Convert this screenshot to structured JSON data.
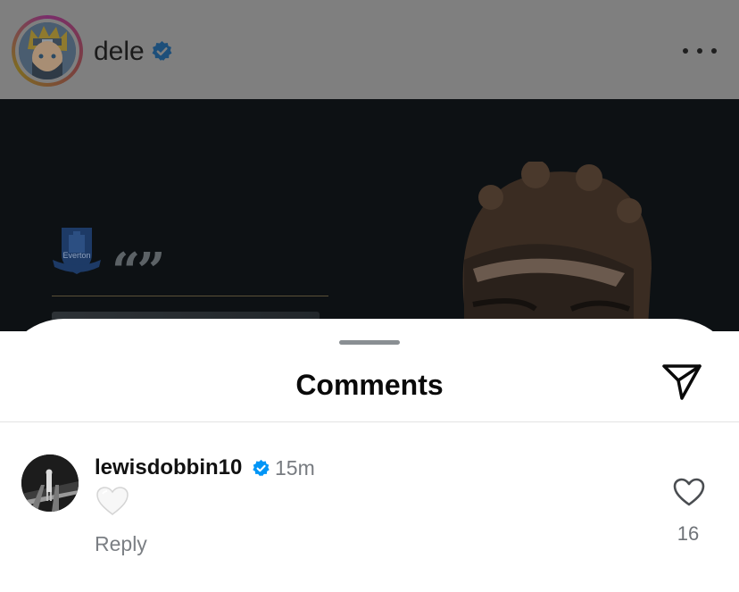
{
  "post": {
    "username": "dele",
    "verified": true,
    "more_icon": "ellipsis-icon",
    "image": {
      "crest_icon": "everton-crest-icon",
      "crest_text": "Everton",
      "quote_glyph": "“”"
    }
  },
  "sheet": {
    "title": "Comments",
    "share_icon": "paper-plane-icon"
  },
  "comments": [
    {
      "username": "lewisdobbin10",
      "verified": true,
      "time": "15m",
      "body_emoji": "🤍",
      "reply_label": "Reply",
      "like_count": "16",
      "like_icon": "heart-outline-icon"
    }
  ],
  "colors": {
    "verified_blue": "#0095f6",
    "dim_overlay": "#7f7f7f",
    "secondary_text": "#777b80"
  }
}
